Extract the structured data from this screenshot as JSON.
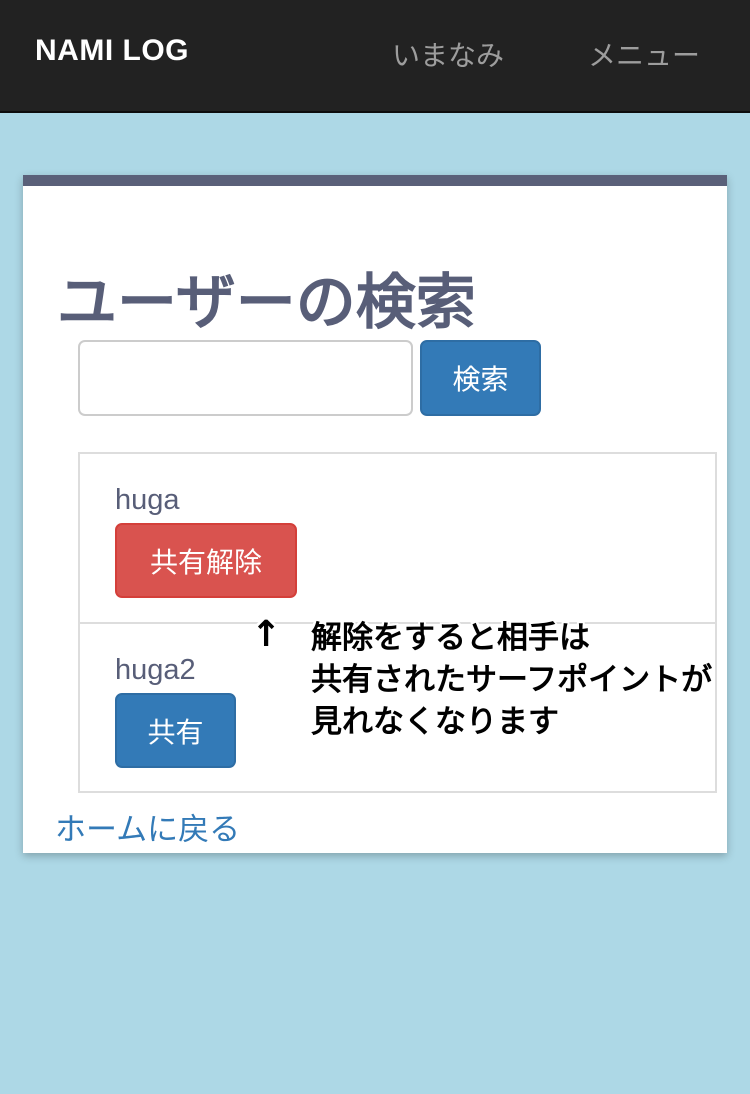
{
  "navbar": {
    "brand": "NAMI LOG",
    "links": [
      "いまなみ",
      "メニュー"
    ]
  },
  "page": {
    "title": "ユーザーの検索",
    "search_button": "検索",
    "home_link": "ホームに戻る"
  },
  "users": [
    {
      "name": "huga",
      "action": "共有解除"
    },
    {
      "name": "huga2",
      "action": "共有"
    }
  ],
  "annotation": {
    "arrow": "↑",
    "lines": [
      "解除をすると相手は",
      "共有されたサーフポイントが",
      "見れなくなります"
    ]
  },
  "colors": {
    "background": "#add8e6",
    "navbar": "#222222",
    "primary": "#337ab7",
    "danger": "#d9534f",
    "title": "#585e78"
  }
}
